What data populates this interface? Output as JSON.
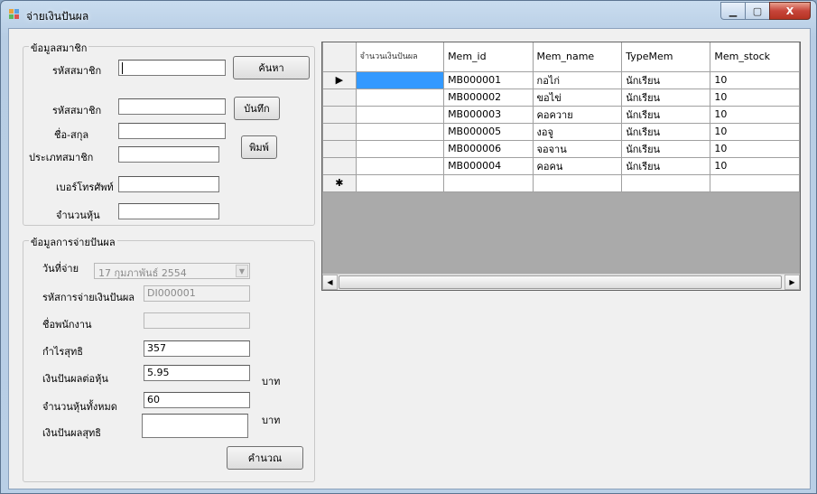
{
  "window": {
    "title": "จ่ายเงินปันผล",
    "caption_buttons": {
      "minimize": "▁",
      "maximize": "▢",
      "close": "X"
    }
  },
  "member_group": {
    "title": "ข้อมูลสมาชิก",
    "search_id_label": "รหัสสมาชิก",
    "search_id_value": "",
    "search_button": "ค้นหา",
    "member_id_label": "รหัสสมาชิก",
    "member_id_value": "",
    "name_label": "ชื่อ-สกุล",
    "name_value": "",
    "type_label": "ประเภทสมาชิก",
    "type_value": "",
    "phone_label": "เบอร์โทรศัพท์",
    "phone_value": "",
    "shares_label": "จำนวนหุ้น",
    "shares_value": "",
    "save_button": "บันทึก",
    "print_button": "พิมพ์"
  },
  "dividend_group": {
    "title": "ข้อมูลการจ่ายปันผล",
    "date_label": "วันที่จ่าย",
    "date_value": "17 กุมภาพันธ์  2554",
    "payment_id_label": "รหัสการจ่ายเงินปันผล",
    "payment_id_value": "DI000001",
    "employee_label": "ชื่อพนักงาน",
    "employee_value": "",
    "profit_label": "กำไรสุทธิ",
    "profit_value": "357",
    "per_share_label": "เงินปันผลต่อหุ้น",
    "per_share_value": "5.95",
    "per_share_unit": "บาท",
    "total_shares_label": "จำนวนหุ้นทั้งหมด",
    "total_shares_value": "60",
    "net_label": "เงินปันผลสุทธิ",
    "net_value": "",
    "net_unit": "บาท",
    "calculate_button": "คำนวณ"
  },
  "grid": {
    "columns": [
      "จำนวนเงินปันผล",
      "Mem_id",
      "Mem_name",
      "TypeMem",
      "Mem_stock"
    ],
    "rows": [
      [
        "",
        "MB000001",
        "กอไก่",
        "นักเรียน",
        "10"
      ],
      [
        "",
        "MB000002",
        "ขอไข่",
        "นักเรียน",
        "10"
      ],
      [
        "",
        "MB000003",
        "คอควาย",
        "นักเรียน",
        "10"
      ],
      [
        "",
        "MB000005",
        "งอจู",
        "นักเรียน",
        "10"
      ],
      [
        "",
        "MB000006",
        "จอจาน",
        "นักเรียน",
        "10"
      ],
      [
        "",
        "MB000004",
        "คอคน",
        "นักเรียน",
        "10"
      ]
    ],
    "current_row_marker": "▶",
    "new_row_marker": "✱",
    "scroll_left": "◀",
    "scroll_right": "▶"
  }
}
